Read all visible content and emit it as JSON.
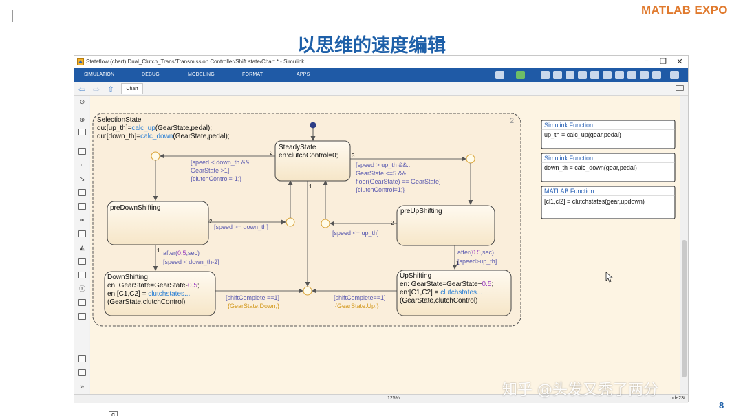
{
  "slide": {
    "brand_name": "MATLAB",
    "brand_event": "EXPO",
    "title": "以思维的速度编辑",
    "page_number": "8",
    "watermark": "知乎 @头发又秃了两分"
  },
  "window": {
    "title": "Stateflow (chart) Dual_Clutch_Trans/Transmission Controller/Shift state/Chart * - Simulink",
    "controls": [
      "−",
      "❐",
      "✕"
    ]
  },
  "ribbon": {
    "tabs": [
      "SIMULATION",
      "DEBUG",
      "MODELING",
      "FORMAT",
      "APPS"
    ]
  },
  "nav": {
    "back": "⇦",
    "forward": "⇨",
    "up": "⇧",
    "tab_label": "Chart"
  },
  "status": {
    "zoom": "125%",
    "solver": "ode23t"
  },
  "library_badge": "C",
  "colors": {
    "ribbon": "#1f5aa6",
    "canvas": "#fdf4e3",
    "transition_label": "#5b5bb0",
    "function_call": "#2a7fd4",
    "action_orange": "#d39a20",
    "number_purple": "#9b3fc0"
  },
  "chart": {
    "superstate": {
      "name": "SelectionState",
      "line1_pre": "du:[up_th]=",
      "line1_fn": "calc_up",
      "line1_post": "(GearState,pedal);",
      "line2_pre": "du:[down_th]=",
      "line2_fn": "calc_down",
      "line2_post": "(GearState,pedal);",
      "decomposition_number": "2"
    },
    "states": {
      "steady": {
        "name": "SteadyState",
        "action": "en:clutchControl=0;"
      },
      "pre_down": {
        "name": "preDownShifting"
      },
      "pre_up": {
        "name": "preUpShifting"
      },
      "down": {
        "name": "DownShifting",
        "l1_pre": "en: GearState=GearState-",
        "l1_num": "0.5",
        "l1_post": ";",
        "l2_pre": "en:[C1,C2] = ",
        "l2_fn": "clutchstates...",
        "l3": "(GearState,clutchControl)"
      },
      "up": {
        "name": "UpShifting",
        "l1_pre": "en: GearState=GearState+",
        "l1_num": "0.5",
        "l1_post": ";",
        "l2_pre": "en:[C1,C2] = ",
        "l2_fn": "clutchstates...",
        "l3": "(GearState,clutchControl)"
      }
    },
    "transitions": {
      "to_down_1": "[speed < down_th && ...",
      "to_down_2": "GearState >1]",
      "to_down_3": "{clutchControl=-1;}",
      "to_up_1": "[speed > up_th &&...",
      "to_up_2": "GearState <=5 && ...",
      "to_up_3": "floor(GearState) == GearState]",
      "to_up_4": "{clutchControl=1;}",
      "predown_back": "[speed >= down_th]",
      "preup_back": "[speed <= up_th]",
      "after_down_fn": "after(",
      "after_down_num": "0.5",
      "after_down_post": ",sec)",
      "after_down_cond": "[speed < down_th-2]",
      "after_up_fn": "after(",
      "after_up_num": "0.5",
      "after_up_post": ",sec)",
      "after_up_cond": "[speed>up_th]",
      "shift_down_cond": "[shiftComplete ==1]",
      "shift_down_act": "{GearState.Down;}",
      "shift_up_cond": "[shiftComplete==1]",
      "shift_up_act": "{GearState.Up;}"
    },
    "priorities": {
      "steady_left": "2",
      "steady_right": "3",
      "steady_down": "1",
      "predown_right": "2",
      "preup_left": "2",
      "predown_down": "1",
      "preup_down": "1"
    },
    "functions": [
      {
        "kind": "Simulink Function",
        "signature": "up_th = calc_up(gear,pedal)"
      },
      {
        "kind": "Simulink Function",
        "signature": "down_th = calc_down(gear,pedal)"
      },
      {
        "kind": "MATLAB Function",
        "signature": "[cl1,cl2] = clutchstates(gear,updown)"
      }
    ]
  }
}
